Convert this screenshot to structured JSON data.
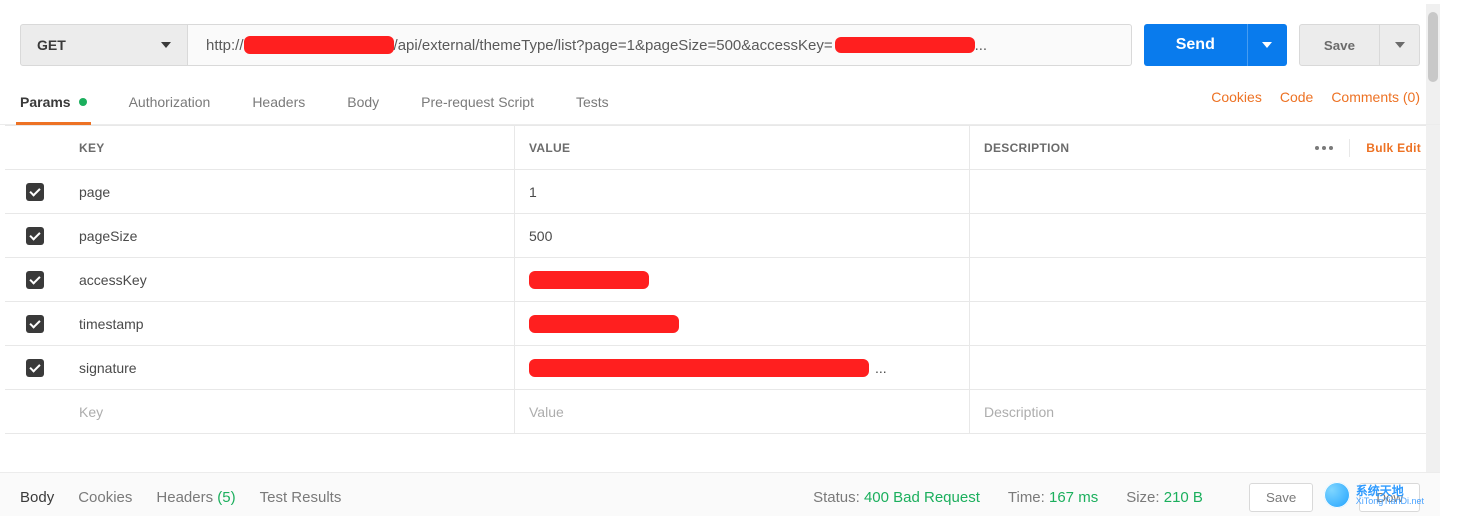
{
  "topbar": {
    "method": "GET",
    "url_prefix": "http://",
    "url_suffix": "/api/external/themeType/list?page=1&pageSize=500&accessKey=",
    "send_label": "Send",
    "save_label": "Save"
  },
  "tabs": {
    "items": [
      {
        "label": "Params",
        "active": true,
        "has_dot": true
      },
      {
        "label": "Authorization"
      },
      {
        "label": "Headers"
      },
      {
        "label": "Body"
      },
      {
        "label": "Pre-request Script"
      },
      {
        "label": "Tests"
      }
    ],
    "right": {
      "cookies": "Cookies",
      "code": "Code",
      "comments": "Comments (0)"
    }
  },
  "param_headers": {
    "key": "KEY",
    "value": "VALUE",
    "description": "DESCRIPTION",
    "bulk": "Bulk Edit"
  },
  "params": [
    {
      "checked": true,
      "key": "page",
      "value": "1",
      "redacted": false,
      "redact_w": 0
    },
    {
      "checked": true,
      "key": "pageSize",
      "value": "500",
      "redacted": false,
      "redact_w": 0
    },
    {
      "checked": true,
      "key": "accessKey",
      "value": "",
      "redacted": true,
      "redact_w": 120
    },
    {
      "checked": true,
      "key": "timestamp",
      "value": "",
      "redacted": true,
      "redact_w": 150
    },
    {
      "checked": true,
      "key": "signature",
      "value": "...",
      "redacted": true,
      "redact_w": 340
    }
  ],
  "placeholders": {
    "key": "Key",
    "value": "Value",
    "description": "Description"
  },
  "footer": {
    "tabs": {
      "body": "Body",
      "cookies": "Cookies",
      "headers": "Headers",
      "headers_count": "(5)",
      "tests": "Test Results"
    },
    "status_label": "Status:",
    "status_value": "400 Bad Request",
    "time_label": "Time:",
    "time_value": "167 ms",
    "size_label": "Size:",
    "size_value": "210 B",
    "save_response": "Save",
    "download": "Dow"
  },
  "watermark": {
    "title": "系统天地",
    "sub": "XiTongTianDi.net"
  }
}
